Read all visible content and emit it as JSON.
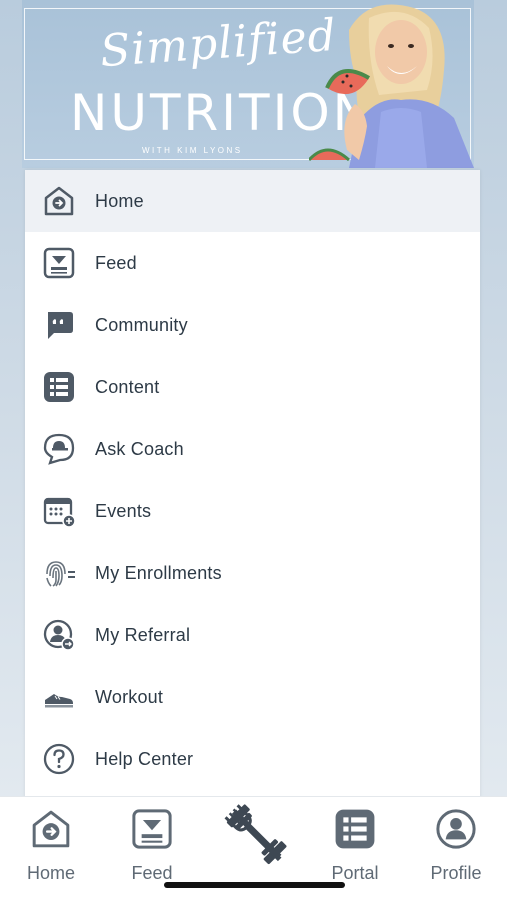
{
  "banner": {
    "script_text": "Simplified",
    "main_text": "NUTRITION",
    "sub_text": "WITH KIM LYONS"
  },
  "menu": {
    "items": [
      {
        "label": "Home",
        "icon": "home-icon",
        "active": true
      },
      {
        "label": "Feed",
        "icon": "feed-icon",
        "active": false
      },
      {
        "label": "Community",
        "icon": "community-icon",
        "active": false
      },
      {
        "label": "Content",
        "icon": "content-icon",
        "active": false
      },
      {
        "label": "Ask Coach",
        "icon": "ask-coach-icon",
        "active": false
      },
      {
        "label": "Events",
        "icon": "events-icon",
        "active": false
      },
      {
        "label": "My Enrollments",
        "icon": "fingerprint-icon",
        "active": false
      },
      {
        "label": "My Referral",
        "icon": "referral-icon",
        "active": false
      },
      {
        "label": "Workout",
        "icon": "shoe-icon",
        "active": false
      },
      {
        "label": "Help Center",
        "icon": "help-icon",
        "active": false
      }
    ]
  },
  "tabbar": {
    "home_label": "Home",
    "feed_label": "Feed",
    "portal_label": "Portal",
    "profile_label": "Profile"
  },
  "colors": {
    "icon": "#5f6a75",
    "text": "#2d3a46",
    "active_bg": "#eef1f5",
    "background_top": "#b9ccdd"
  }
}
